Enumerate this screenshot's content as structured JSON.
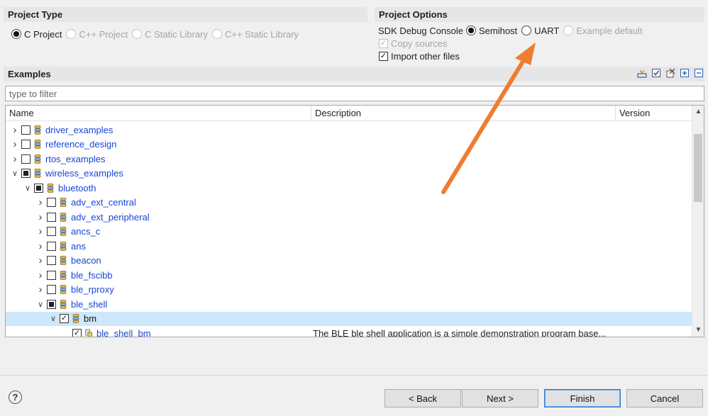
{
  "project_type": {
    "title": "Project Type",
    "options": [
      {
        "label": "C Project",
        "selected": true,
        "enabled": true
      },
      {
        "label": "C++ Project",
        "selected": false,
        "enabled": false
      },
      {
        "label": "C Static Library",
        "selected": false,
        "enabled": false
      },
      {
        "label": "C++ Static Library",
        "selected": false,
        "enabled": false
      }
    ]
  },
  "project_options": {
    "title": "Project Options",
    "sdk_console_label": "SDK Debug Console",
    "console_options": [
      {
        "label": "Semihost",
        "selected": true,
        "enabled": true
      },
      {
        "label": "UART",
        "selected": false,
        "enabled": true
      },
      {
        "label": "Example default",
        "selected": false,
        "enabled": false
      }
    ],
    "copy_sources": {
      "label": "Copy sources",
      "checked": true,
      "enabled": false
    },
    "import_other_files": {
      "label": "Import other files",
      "checked": true,
      "enabled": true
    }
  },
  "examples": {
    "title": "Examples",
    "filter_placeholder": "type to filter",
    "columns": {
      "name": "Name",
      "description": "Description",
      "version": "Version"
    },
    "rows": [
      {
        "label": "driver_examples",
        "depth": 0,
        "expanded": false,
        "check": "none",
        "description": ""
      },
      {
        "label": "reference_design",
        "depth": 0,
        "expanded": false,
        "check": "none",
        "description": ""
      },
      {
        "label": "rtos_examples",
        "depth": 0,
        "expanded": false,
        "check": "none",
        "description": ""
      },
      {
        "label": "wireless_examples",
        "depth": 0,
        "expanded": true,
        "check": "partial",
        "description": ""
      },
      {
        "label": "bluetooth",
        "depth": 1,
        "expanded": true,
        "check": "partial",
        "description": ""
      },
      {
        "label": "adv_ext_central",
        "depth": 2,
        "expanded": false,
        "check": "none",
        "description": ""
      },
      {
        "label": "adv_ext_peripheral",
        "depth": 2,
        "expanded": false,
        "check": "none",
        "description": ""
      },
      {
        "label": "ancs_c",
        "depth": 2,
        "expanded": false,
        "check": "none",
        "description": ""
      },
      {
        "label": "ans",
        "depth": 2,
        "expanded": false,
        "check": "none",
        "description": ""
      },
      {
        "label": "beacon",
        "depth": 2,
        "expanded": false,
        "check": "none",
        "description": ""
      },
      {
        "label": "ble_fscibb",
        "depth": 2,
        "expanded": false,
        "check": "none",
        "description": ""
      },
      {
        "label": "ble_rproxy",
        "depth": 2,
        "expanded": false,
        "check": "none",
        "description": ""
      },
      {
        "label": "ble_shell",
        "depth": 2,
        "expanded": true,
        "check": "partial",
        "description": ""
      },
      {
        "label": "bm",
        "depth": 3,
        "expanded": true,
        "check": "checked",
        "description": "",
        "selected": true
      },
      {
        "label": "ble_shell_bm",
        "depth": 4,
        "expanded": null,
        "check": "checked",
        "description": "The BLE ble shell application is a simple demonstration program base..."
      }
    ]
  },
  "buttons": {
    "help": "?",
    "back": "< Back",
    "next": "Next >",
    "finish": "Finish",
    "cancel": "Cancel"
  },
  "colors": {
    "accent_arrow": "#ef7d31",
    "link_blue": "#1646d6",
    "selection": "#cde8fb"
  }
}
